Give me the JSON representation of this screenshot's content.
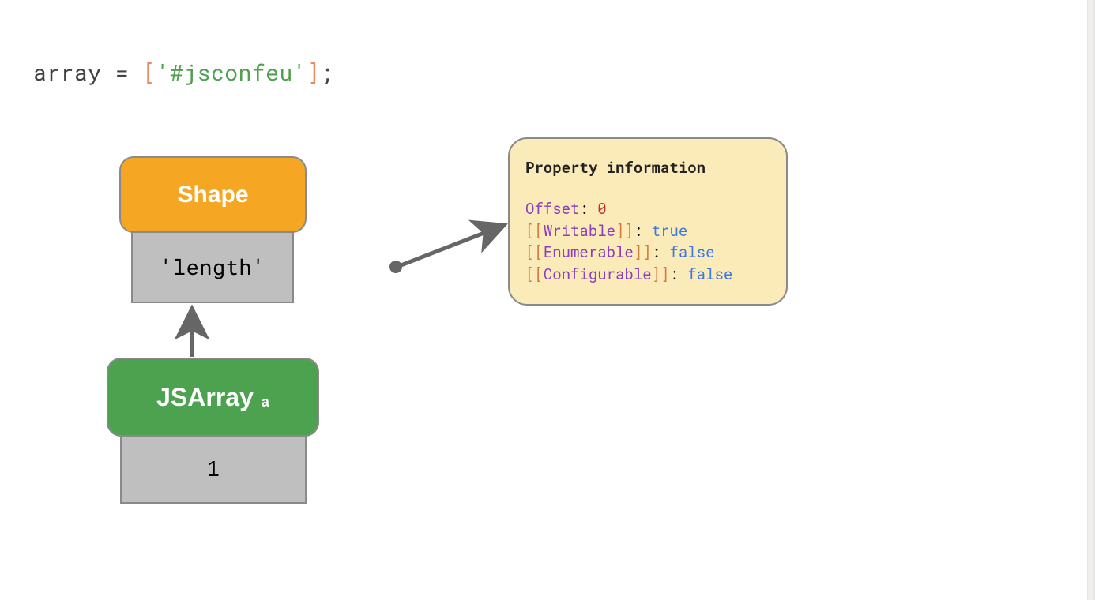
{
  "code": {
    "var_name": "array",
    "equals": " = ",
    "open_bracket": "[",
    "string_literal": "'#jsconfeu'",
    "close_bracket": "]",
    "semicolon": ";"
  },
  "shape_box": {
    "title": "Shape",
    "cell": "'length'"
  },
  "array_box": {
    "title": "JSArray",
    "subscript": "a",
    "cell": "1"
  },
  "property_info": {
    "title": "Property information",
    "rows": [
      {
        "key_inner": "Offset",
        "brackets": false,
        "colon": ": ",
        "value": "0",
        "value_color": "red"
      },
      {
        "key_inner": "Writable",
        "brackets": true,
        "colon": ": ",
        "value": "true",
        "value_color": "blue"
      },
      {
        "key_inner": "Enumerable",
        "brackets": true,
        "colon": ": ",
        "value": "false",
        "value_color": "blue"
      },
      {
        "key_inner": "Configurable",
        "brackets": true,
        "colon": ": ",
        "value": "false",
        "value_color": "blue"
      }
    ]
  },
  "colors": {
    "shape_bg": "#f5a623",
    "array_bg": "#4ca24e",
    "panel_bg": "#faebb8",
    "cell_bg": "#bfbfbf",
    "border": "#8a8a8a"
  }
}
